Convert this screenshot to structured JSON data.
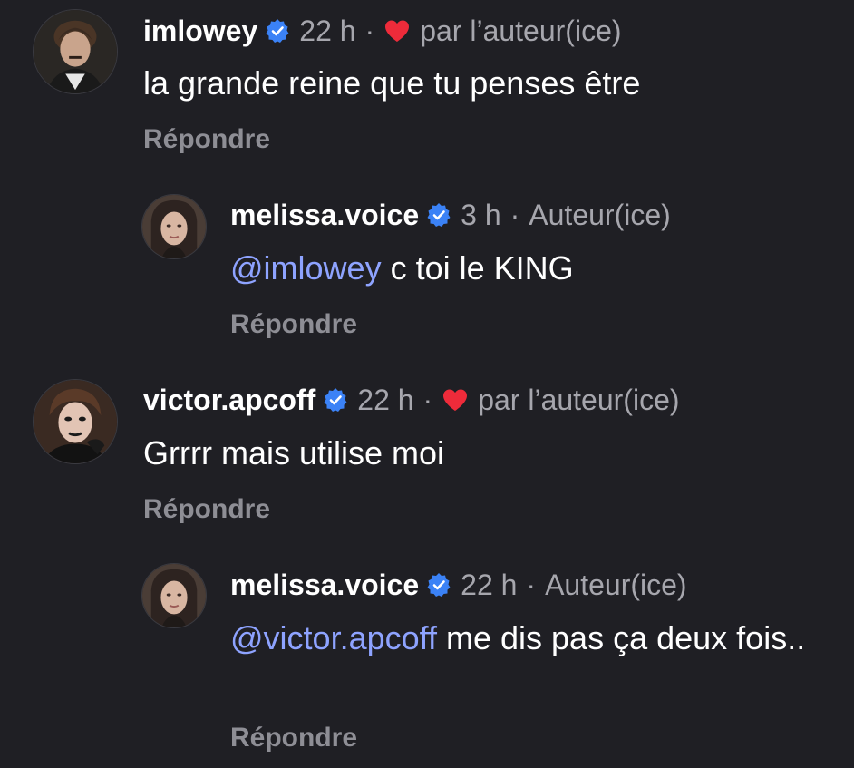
{
  "comments": [
    {
      "username": "imlowey",
      "time": "22 h",
      "liked_label": "par l’auteur(ice)",
      "text": "la grande reine que tu penses être",
      "reply": "Répondre"
    },
    {
      "username": "melissa.voice",
      "time": "3 h",
      "author_label": "Auteur(ice)",
      "mention": "@imlowey",
      "text": " c toi le KING",
      "reply": "Répondre"
    },
    {
      "username": "victor.apcoff",
      "time": "22 h",
      "liked_label": "par l’auteur(ice)",
      "text": "Grrrr mais utilise moi",
      "reply": "Répondre"
    },
    {
      "username": "melissa.voice",
      "time": "22 h",
      "author_label": "Auteur(ice)",
      "mention": "@victor.apcoff",
      "text": " me dis pas ça deux fois..",
      "reply": "Répondre"
    }
  ],
  "colors": {
    "background": "#1f1f24",
    "mention": "#8ea3ff",
    "verified": "#3b82f6",
    "heart": "#ee2b3a",
    "muted": "#a6a6ad"
  },
  "icons": {
    "verified": "verified-badge-icon",
    "heart": "heart-icon",
    "separator": "·"
  }
}
